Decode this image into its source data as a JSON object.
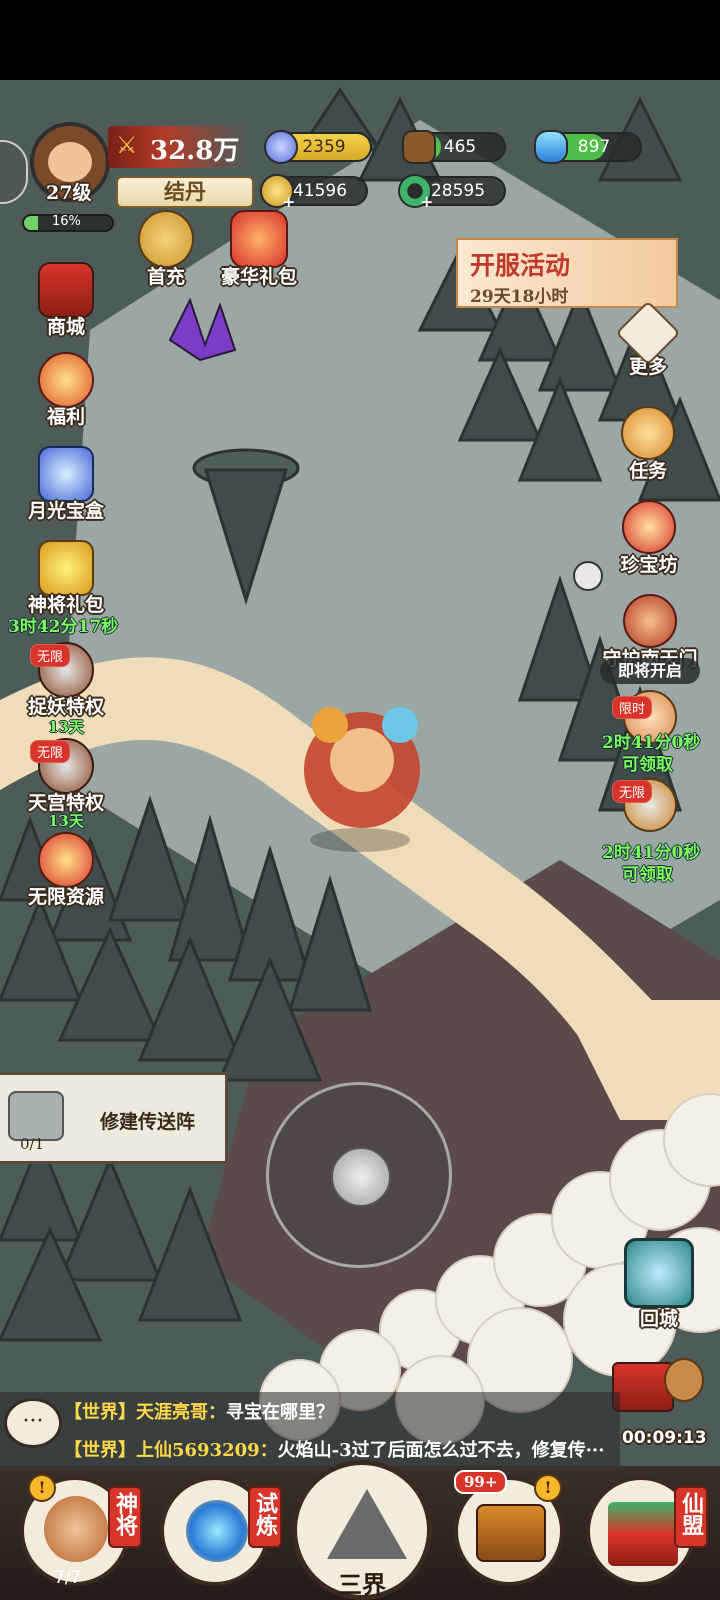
{
  "player": {
    "level": "27级",
    "exp_percent": "16%",
    "exp_fraction": 0.16,
    "power": "32.8万",
    "realm": "结丹"
  },
  "resources": {
    "spirit": "2359",
    "wood": "465",
    "gem": "897",
    "gold": "41596",
    "jade": "28595"
  },
  "top_gifts": {
    "first_recharge": "首充",
    "luxury_pack": "豪华礼包"
  },
  "event_banner": {
    "title": "开服活动",
    "countdown": "29天18小时"
  },
  "left_menu": {
    "shop": "商城",
    "welfare": "福利",
    "moon_box": "月光宝盒",
    "general_pack": "神将礼包",
    "general_pack_timer": "3时42分17秒",
    "catch_demon": "捉妖特权",
    "catch_demon_tag": "无限",
    "catch_demon_days": "13天",
    "heaven_palace": "天宫特权",
    "heaven_palace_tag": "无限",
    "heaven_palace_days": "13天",
    "unlimited_res": "无限资源"
  },
  "right_menu": {
    "more": "更多",
    "tasks": "任务",
    "treasure_shop": "珍宝坊",
    "guard_gate": "守护南天门",
    "guard_gate_status": "即将开启",
    "limited_tag": "限时",
    "limited_timer": "2时41分0秒",
    "limited_claim": "可领取",
    "unlimited_tag": "无限",
    "unlimited_timer": "2时41分0秒",
    "unlimited_claim": "可领取",
    "return_city": "回城"
  },
  "build_panel": {
    "label": "修建传送阵",
    "count": "0/1"
  },
  "chat": {
    "line1_channel": "【世界】",
    "line1_user": "天涯亮哥：",
    "line1_msg": "寻宝在哪里？",
    "line2_channel": "【世界】",
    "line2_user": "上仙5693209：",
    "line2_msg": "火焰山-3过了后面怎么过不去，修复传···"
  },
  "treasure_timer": "00:09:13",
  "bottom_nav": {
    "generals": "神将",
    "generals_count": "7/7",
    "trial": "试炼",
    "three_realms": "三界",
    "bag_badge": "99+",
    "alliance": "仙盟"
  },
  "colors": {
    "map_bg": "#4d5b59",
    "floor": "#9ba7a4",
    "path": "#efdcb8",
    "red_tag": "#d8342a",
    "timer_green": "#7bff5c"
  }
}
